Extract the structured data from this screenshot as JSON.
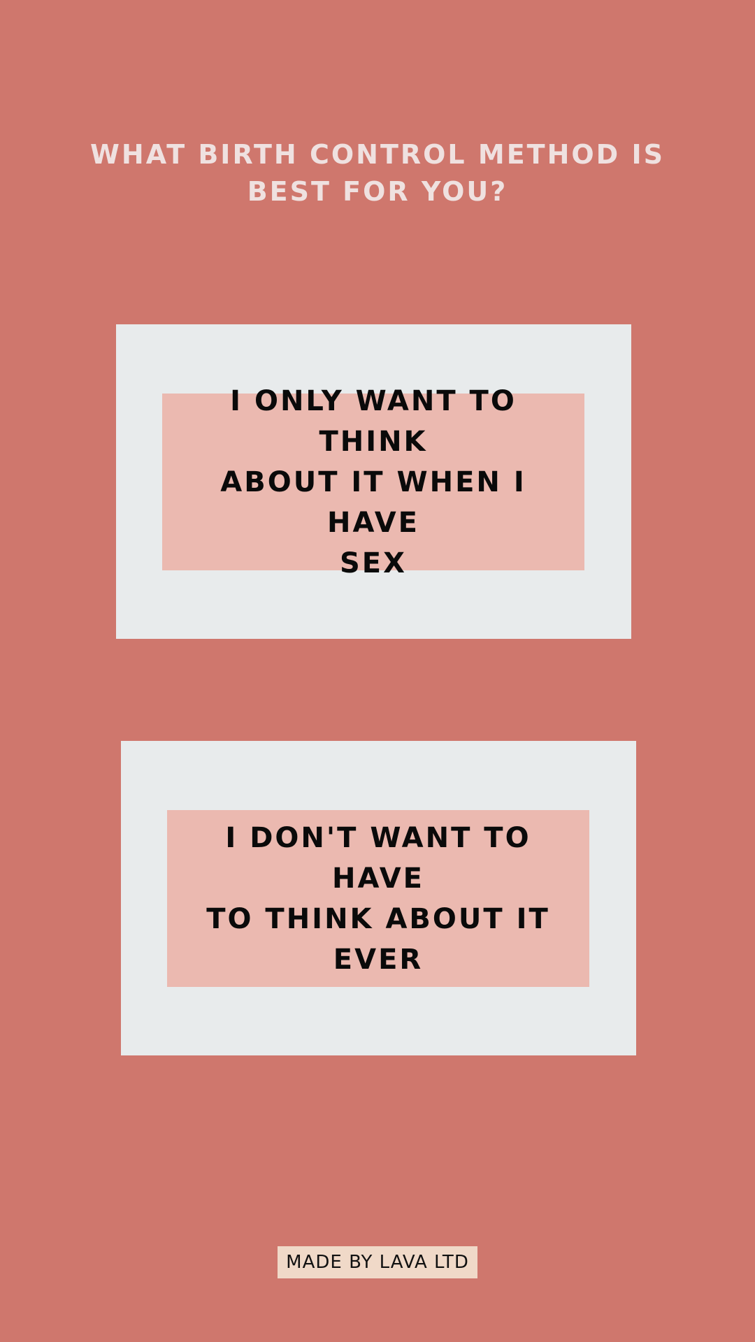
{
  "header": {
    "title_line1": "WHAT BIRTH CONTROL METHOD IS",
    "title_line2": "BEST FOR YOU?"
  },
  "options": [
    {
      "line1": "I ONLY WANT TO THINK",
      "line2": "ABOUT IT WHEN I HAVE",
      "line3": "SEX"
    },
    {
      "line1": "I DON'T WANT TO HAVE",
      "line2": "TO THINK ABOUT IT",
      "line3": "EVER"
    }
  ],
  "footer": {
    "label": "MADE BY LAVA LTD"
  },
  "colors": {
    "background": "#cf776d",
    "card_outer": "#e8ebec",
    "card_inner": "#ebb9b0",
    "title_text": "#efe1e0",
    "footer_badge": "#f0d9c8"
  }
}
